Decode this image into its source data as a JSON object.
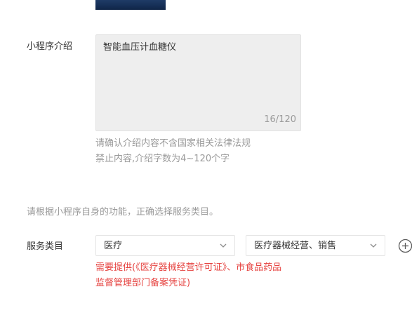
{
  "intro": {
    "label": "小程序介绍",
    "value": "智能血压计血糖仪",
    "counter": "16/120",
    "hint_line1": "请确认介绍内容不含国家相关法律法规",
    "hint_line2": "禁止内容,介绍字数为4~120个字"
  },
  "category": {
    "instruction": "请根据小程序自身的功能，正确选择服务类目。",
    "label": "服务类目",
    "primary_select": "医疗",
    "secondary_select": "医疗器械经营、销售",
    "requirement_line1": "需要提供(《医疗器械经营许可证》、市食品药品",
    "requirement_line2": "监督管理部门备案凭证)"
  },
  "icons": {
    "chevron": "chevron-down-icon",
    "add": "plus-circle-icon"
  },
  "colors": {
    "warning": "#e64340",
    "hint": "#9a9a9a",
    "textarea_bg": "#eeeeee"
  }
}
